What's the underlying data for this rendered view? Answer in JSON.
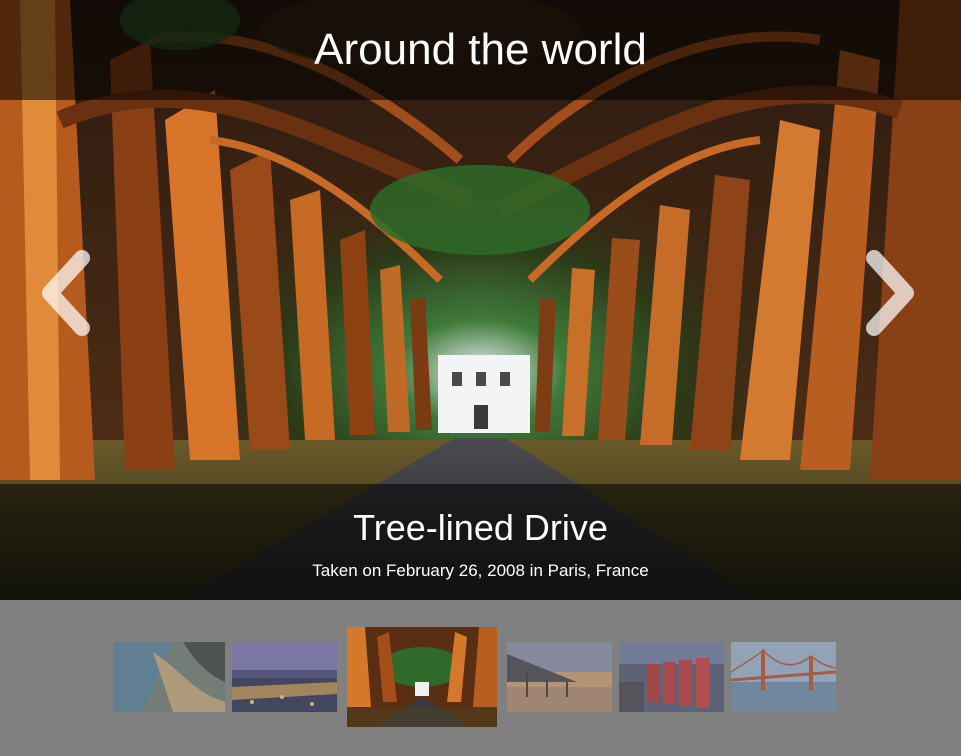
{
  "gallery": {
    "title": "Around the world",
    "current": {
      "title": "Tree-lined Drive",
      "subtitle": "Taken on February 26, 2008 in Paris, France"
    },
    "nav": {
      "prev_icon": "chevron-left-icon",
      "next_icon": "chevron-right-icon"
    },
    "thumbnails": [
      {
        "name": "thumb-coastline",
        "active": false
      },
      {
        "name": "thumb-city-night",
        "active": false
      },
      {
        "name": "thumb-tree-lined-drive",
        "active": true
      },
      {
        "name": "thumb-pier-sunset",
        "active": false
      },
      {
        "name": "thumb-red-phone-booths",
        "active": false
      },
      {
        "name": "thumb-golden-gate-bridge",
        "active": false
      }
    ]
  },
  "colors": {
    "overlay": "#000000",
    "strip_background": "#808080",
    "text": "#ffffff"
  }
}
